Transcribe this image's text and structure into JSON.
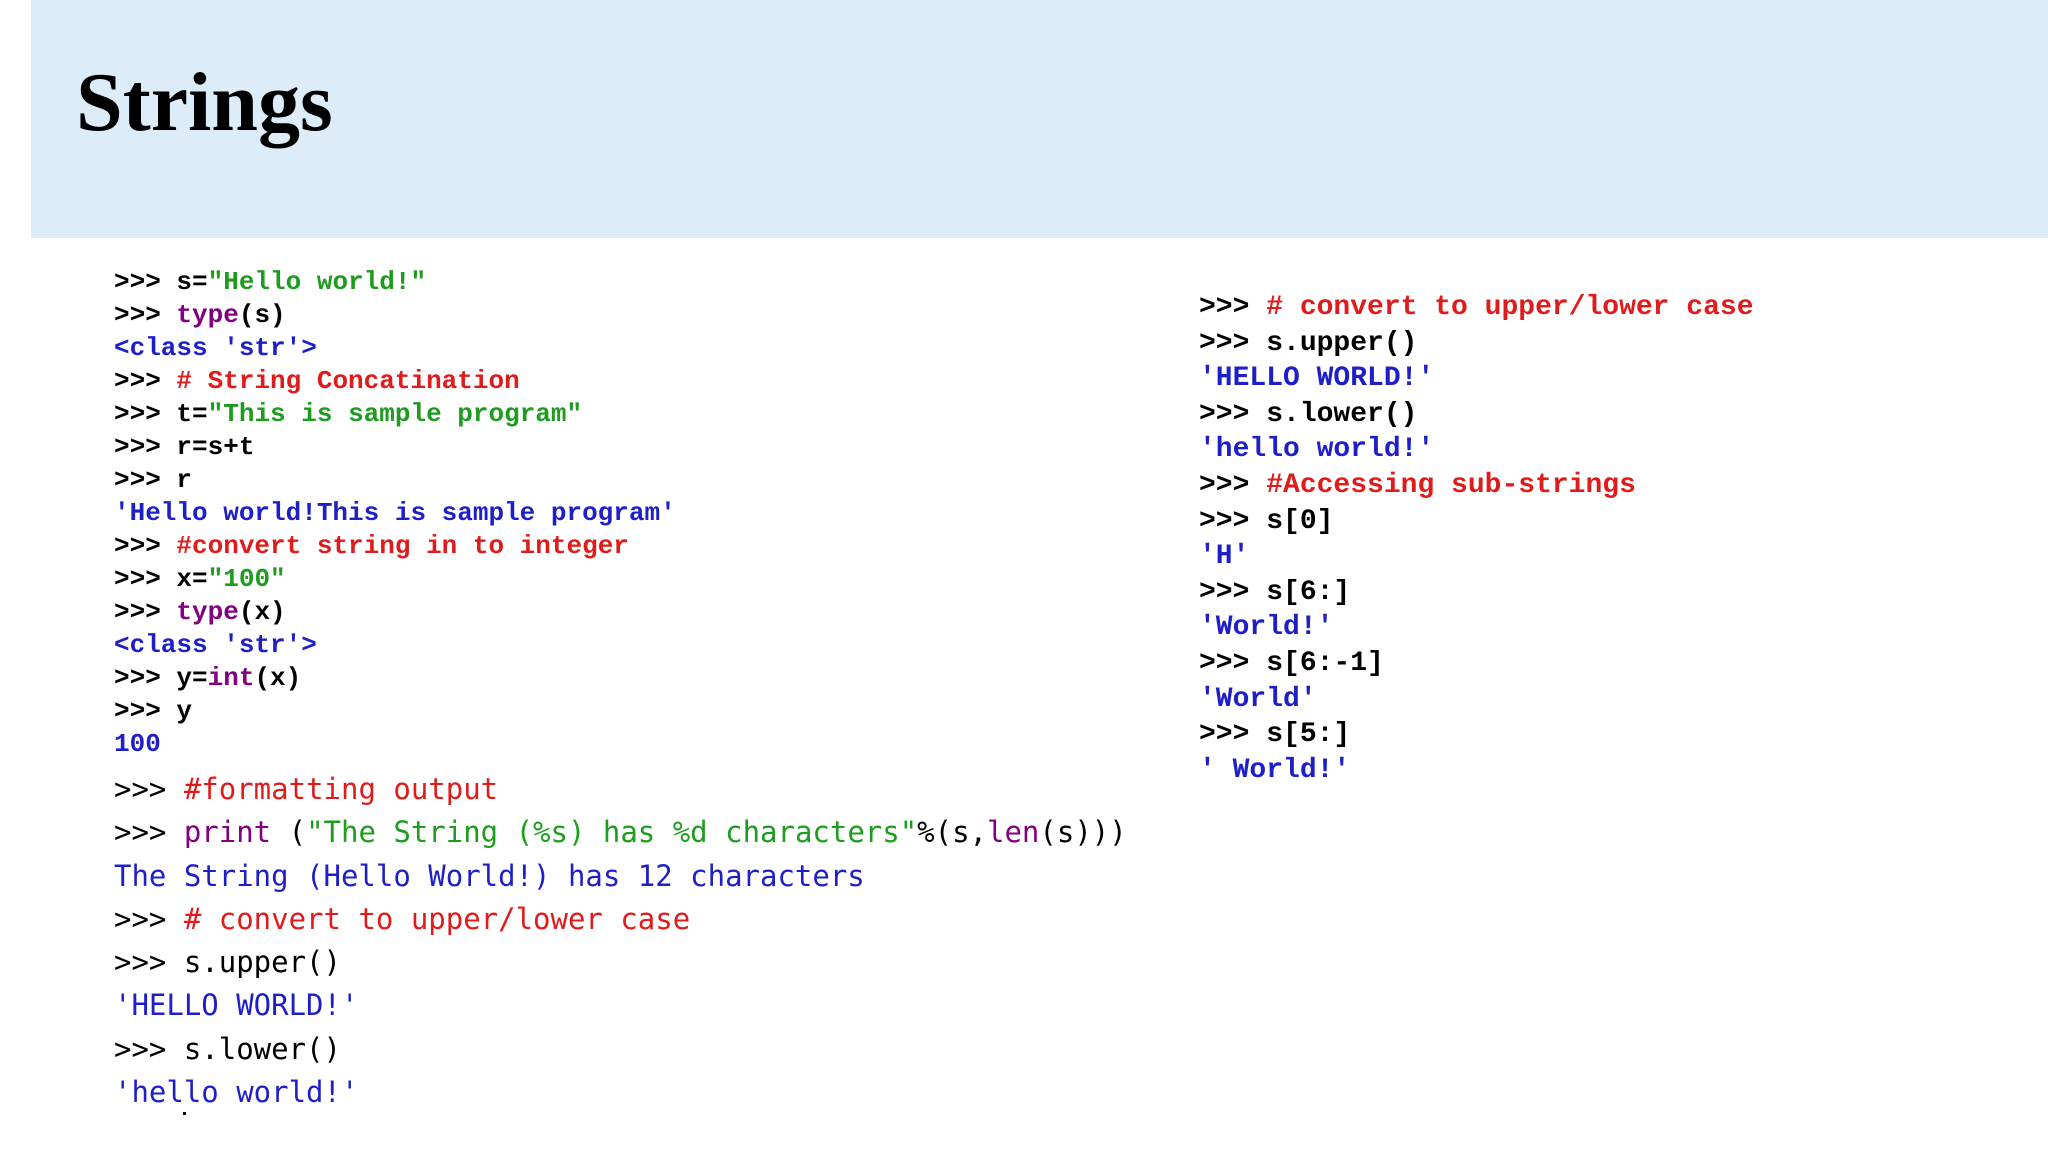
{
  "slide": {
    "title": "Strings"
  },
  "colors": {
    "header_band": "#dcedf9",
    "prompt": "#000000",
    "keyword": "#800080",
    "string_literal": "#1e9c1e",
    "comment": "#e01b1b",
    "output": "#1f1fc8"
  },
  "panels": {
    "upper_left": [
      [
        {
          "t": ">>> ",
          "k": "prompt"
        },
        {
          "t": "s=",
          "k": "plain"
        },
        {
          "t": "\"Hello world!\"",
          "k": "str"
        }
      ],
      [
        {
          "t": ">>> ",
          "k": "prompt"
        },
        {
          "t": "type",
          "k": "kw"
        },
        {
          "t": "(s)",
          "k": "plain"
        }
      ],
      [
        {
          "t": "<class 'str'>",
          "k": "out"
        }
      ],
      [
        {
          "t": ">>> ",
          "k": "prompt"
        },
        {
          "t": "# String Concatination",
          "k": "cmt"
        }
      ],
      [
        {
          "t": ">>> ",
          "k": "prompt"
        },
        {
          "t": "t=",
          "k": "plain"
        },
        {
          "t": "\"This is sample program\"",
          "k": "str"
        }
      ],
      [
        {
          "t": ">>> ",
          "k": "prompt"
        },
        {
          "t": "r=s+t",
          "k": "plain"
        }
      ],
      [
        {
          "t": ">>> ",
          "k": "prompt"
        },
        {
          "t": "r",
          "k": "plain"
        }
      ],
      [
        {
          "t": "'Hello world!This is sample program'",
          "k": "out"
        }
      ],
      [
        {
          "t": ">>> ",
          "k": "prompt"
        },
        {
          "t": "#convert string in to integer",
          "k": "cmt"
        }
      ],
      [
        {
          "t": ">>> ",
          "k": "prompt"
        },
        {
          "t": "x=",
          "k": "plain"
        },
        {
          "t": "\"100\"",
          "k": "str"
        }
      ],
      [
        {
          "t": ">>> ",
          "k": "prompt"
        },
        {
          "t": "type",
          "k": "kw"
        },
        {
          "t": "(x)",
          "k": "plain"
        }
      ],
      [
        {
          "t": "<class 'str'>",
          "k": "out"
        }
      ],
      [
        {
          "t": ">>> ",
          "k": "prompt"
        },
        {
          "t": "y=",
          "k": "plain"
        },
        {
          "t": "int",
          "k": "kw"
        },
        {
          "t": "(x)",
          "k": "plain"
        }
      ],
      [
        {
          "t": ">>> ",
          "k": "prompt"
        },
        {
          "t": "y",
          "k": "plain"
        }
      ],
      [
        {
          "t": "100",
          "k": "out"
        }
      ]
    ],
    "lower_left": [
      [
        {
          "t": ">>> ",
          "k": "prompt"
        },
        {
          "t": "#formatting output",
          "k": "cmt"
        }
      ],
      [
        {
          "t": ">>> ",
          "k": "prompt"
        },
        {
          "t": "print",
          "k": "kw"
        },
        {
          "t": " (",
          "k": "plain"
        },
        {
          "t": "\"The String (%s) has %d characters\"",
          "k": "str"
        },
        {
          "t": "%(s,",
          "k": "plain"
        },
        {
          "t": "len",
          "k": "kw"
        },
        {
          "t": "(s)))",
          "k": "plain"
        }
      ],
      [
        {
          "t": "The String (Hello World!) has 12 characters",
          "k": "out"
        }
      ],
      [
        {
          "t": ">>> ",
          "k": "prompt"
        },
        {
          "t": "# convert to upper/lower case",
          "k": "cmt"
        }
      ],
      [
        {
          "t": ">>> ",
          "k": "prompt"
        },
        {
          "t": "s.upper()",
          "k": "plain"
        }
      ],
      [
        {
          "t": "'HELLO WORLD!'",
          "k": "out"
        }
      ],
      [
        {
          "t": ">>> ",
          "k": "prompt"
        },
        {
          "t": "s.lower()",
          "k": "plain"
        }
      ],
      [
        {
          "t": "'hello world!'",
          "k": "out"
        }
      ]
    ],
    "right": [
      [
        {
          "t": ">>> ",
          "k": "prompt"
        },
        {
          "t": "# convert to upper/lower case",
          "k": "cmt"
        }
      ],
      [
        {
          "t": ">>> ",
          "k": "prompt"
        },
        {
          "t": "s.upper()",
          "k": "plain"
        }
      ],
      [
        {
          "t": "'HELLO WORLD!'",
          "k": "out"
        }
      ],
      [
        {
          "t": ">>> ",
          "k": "prompt"
        },
        {
          "t": "s.lower()",
          "k": "plain"
        }
      ],
      [
        {
          "t": "'hello world!'",
          "k": "out"
        }
      ],
      [
        {
          "t": ">>> ",
          "k": "prompt"
        },
        {
          "t": "#Accessing sub-strings",
          "k": "cmt"
        }
      ],
      [
        {
          "t": ">>> ",
          "k": "prompt"
        },
        {
          "t": "s[0]",
          "k": "plain"
        }
      ],
      [
        {
          "t": "'H'",
          "k": "out"
        }
      ],
      [
        {
          "t": ">>> ",
          "k": "prompt"
        },
        {
          "t": "s[6:]",
          "k": "plain"
        }
      ],
      [
        {
          "t": "'World!'",
          "k": "out"
        }
      ],
      [
        {
          "t": ">>> ",
          "k": "prompt"
        },
        {
          "t": "s[6:-1]",
          "k": "plain"
        }
      ],
      [
        {
          "t": "'World'",
          "k": "out"
        }
      ],
      [
        {
          "t": ">>> ",
          "k": "prompt"
        },
        {
          "t": "s[5:]",
          "k": "plain"
        }
      ],
      [
        {
          "t": "' World!'",
          "k": "out"
        }
      ]
    ]
  }
}
